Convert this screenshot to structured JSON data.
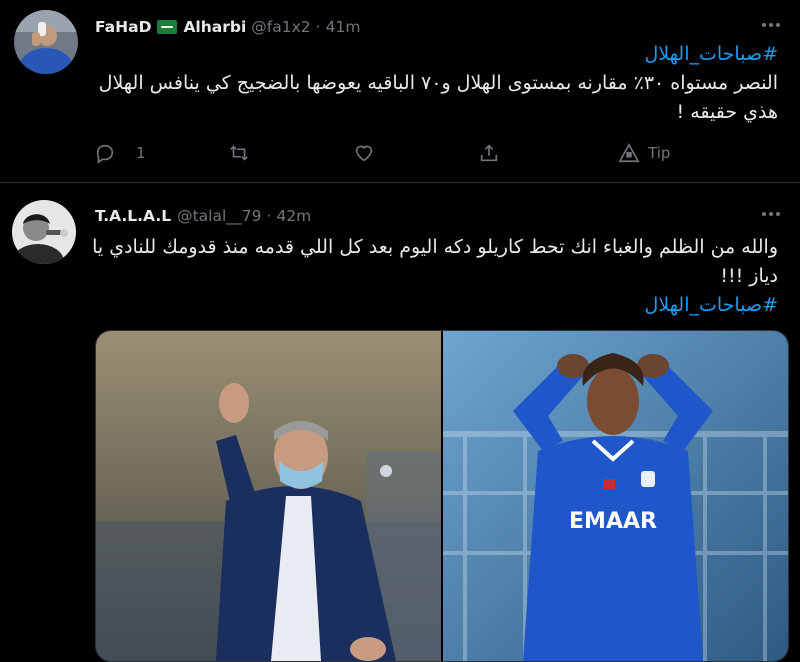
{
  "tweets": [
    {
      "display_name": "FaHaD",
      "display_name_2": "Alharbi",
      "handle": "@fa1x2",
      "separator": "·",
      "time": "41m",
      "hashtag": "#صباحات_الهلال",
      "text": "النصر مستواه ٣٠٪ مقارنه بمستوى الهلال و٧٠ الباقيه يعوضها بالضجيج كي ينافس الهلال هذي حقيقه !",
      "reply_count": "1",
      "tip_label": "Tip"
    },
    {
      "display_name": "T.A.L.A.L",
      "handle": "@talal__79",
      "separator": "·",
      "time": "42m",
      "text": "والله من الظلم والغباء انك تحط كاريلو دكه اليوم بعد كل اللي قدمه منذ قدومك للنادي يا دياز !!!",
      "hashtag": "#صباحات_الهلال",
      "jersey_text": "EMAAR"
    }
  ],
  "colors": {
    "background": "#000000",
    "link": "#1d9bf0",
    "muted": "#71767b",
    "text": "#e7e9ea",
    "jersey": "#1f56c9"
  },
  "icons": [
    "more-icon",
    "reply-icon",
    "retweet-icon",
    "like-icon",
    "share-icon",
    "tip-icon",
    "flag-icon"
  ]
}
